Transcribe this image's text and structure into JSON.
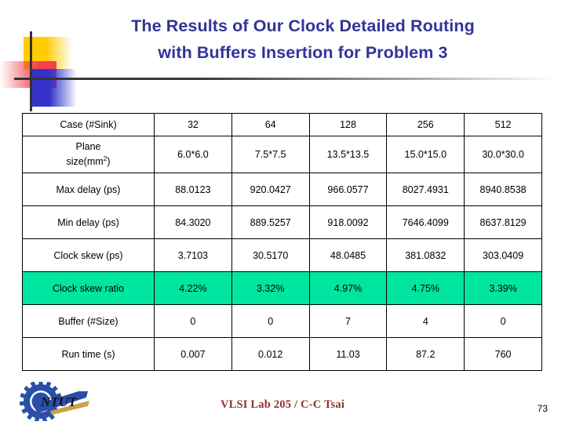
{
  "slide": {
    "title_line1": "The Results of Our Clock Detailed Routing",
    "title_line2": "with Buffers Insertion for Problem 3",
    "title_color": "#333399"
  },
  "decoration": {
    "yellow": "#FFCC00",
    "red": "#F4414E",
    "blue": "#3333CC",
    "rule": "#333333"
  },
  "table": {
    "highlight_color": "#00E5A0",
    "columns": [
      "Case (#Sink)",
      "32",
      "64",
      "128",
      "256",
      "512"
    ],
    "rows": [
      {
        "label": "Case (#Sink)",
        "values": [
          "32",
          "64",
          "128",
          "256",
          "512"
        ],
        "highlight": false
      },
      {
        "label_line1": "Plane",
        "label_line2_pre": "size(mm",
        "label_line2_sup": "2",
        "label_line2_post": ")",
        "label": "Plane size(mm2)",
        "values": [
          "6.0*6.0",
          "7.5*7.5",
          "13.5*13.5",
          "15.0*15.0",
          "30.0*30.0"
        ],
        "highlight": false
      },
      {
        "label": "Max delay (ps)",
        "values": [
          "88.0123",
          "920.0427",
          "966.0577",
          "8027.4931",
          "8940.8538"
        ],
        "highlight": false
      },
      {
        "label": "Min delay (ps)",
        "values": [
          "84.3020",
          "889.5257",
          "918.0092",
          "7646.4099",
          "8637.8129"
        ],
        "highlight": false
      },
      {
        "label": "Clock skew (ps)",
        "values": [
          "3.7103",
          "30.5170",
          "48.0485",
          "381.0832",
          "303.0409"
        ],
        "highlight": false
      },
      {
        "label": "Clock skew ratio",
        "values": [
          "4.22%",
          "3.32%",
          "4.97%",
          "4.75%",
          "3.39%"
        ],
        "highlight": true
      },
      {
        "label": "Buffer (#Size)",
        "values": [
          "0",
          "0",
          "7",
          "4",
          "0"
        ],
        "highlight": false
      },
      {
        "label": "Run time (s)",
        "values": [
          "0.007",
          "0.012",
          "11.03",
          "87.2",
          "760"
        ],
        "highlight": false
      }
    ]
  },
  "footer": {
    "logo_text": "NTUT",
    "caption": "VLSI Lab 205 / C-C Tsai",
    "caption_color": "#8B3626",
    "page_number": "73"
  }
}
